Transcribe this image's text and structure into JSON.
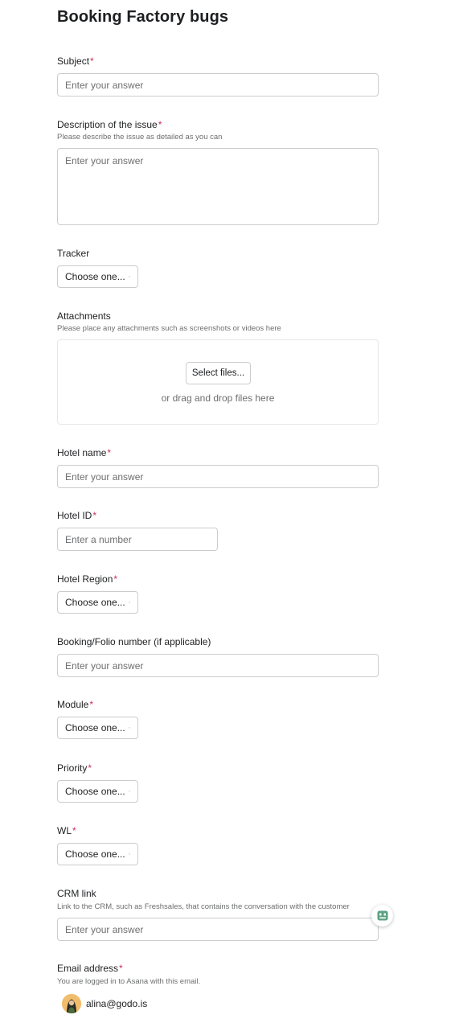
{
  "form": {
    "title": "Booking Factory bugs",
    "required_marker": "*"
  },
  "fields": {
    "subject": {
      "label": "Subject",
      "placeholder": "Enter your answer"
    },
    "description": {
      "label": "Description of the issue",
      "helper": "Please describe the issue as detailed as you can",
      "placeholder": "Enter your answer"
    },
    "tracker": {
      "label": "Tracker",
      "select": "Choose one..."
    },
    "attachments": {
      "label": "Attachments",
      "helper": "Please place any attachments such as screenshots or videos here",
      "button": "Select files...",
      "drop_text": "or drag and drop files here"
    },
    "hotel_name": {
      "label": "Hotel name",
      "placeholder": "Enter your answer"
    },
    "hotel_id": {
      "label": "Hotel ID",
      "placeholder": "Enter a number"
    },
    "hotel_region": {
      "label": "Hotel Region",
      "select": "Choose one..."
    },
    "booking_number": {
      "label": "Booking/Folio number (if applicable)",
      "placeholder": "Enter your answer"
    },
    "module": {
      "label": "Module",
      "select": "Choose one..."
    },
    "priority": {
      "label": "Priority",
      "select": "Choose one..."
    },
    "wl": {
      "label": "WL",
      "select": "Choose one..."
    },
    "crm_link": {
      "label": "CRM link",
      "helper": "Link to the CRM, such as Freshsales, that contains the conversation with the customer",
      "placeholder": "Enter your answer"
    },
    "email": {
      "label": "Email address",
      "helper": "You are logged in to Asana with this email.",
      "value": "alina@godo.is"
    }
  },
  "icons": {
    "chevron": "chevron-down-icon",
    "help": "help-widget-icon",
    "avatar": "user-avatar"
  },
  "colors": {
    "required": "#c92f54",
    "help_icon": "#5da283",
    "avatar_bg": "#f1bd6c"
  }
}
